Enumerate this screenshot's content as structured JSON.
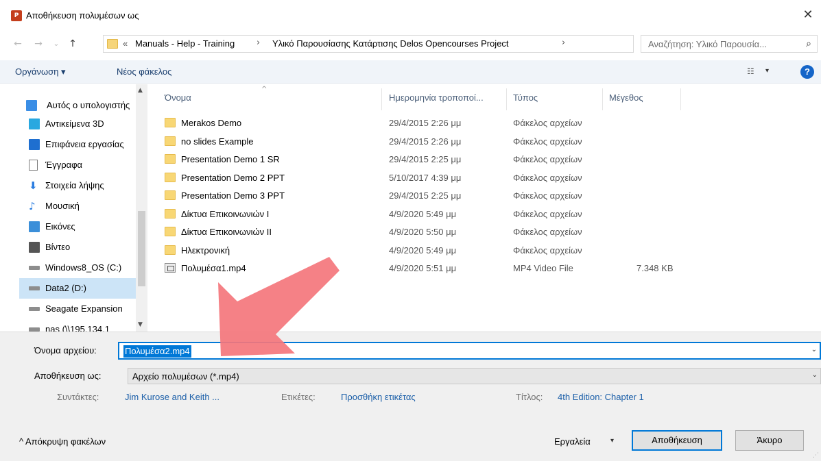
{
  "window": {
    "title": "Αποθήκευση πολυμέσων ως",
    "app_icon_text": "P",
    "close_glyph": "✕"
  },
  "address": {
    "back_glyph": "←",
    "forward_glyph": "→",
    "recent_glyph": "⌄",
    "up_glyph": "↑",
    "overflow": "«",
    "crumbs": [
      "Manuals - Help - Training",
      "Υλικό Παρουσίασης Κατάρτισης Delos Opencourses Project"
    ],
    "sep": "›",
    "dropdown_glyph": "⌄",
    "refresh_glyph": "↻",
    "search_placeholder": "Αναζήτηση: Υλικό Παρουσία...",
    "search_glyph": "⌕"
  },
  "toolbar": {
    "organize": "Οργάνωση ▾",
    "new_folder": "Νέος φάκελος",
    "view_glyph": "☷",
    "view_arrow": "▾",
    "help": "?"
  },
  "nav": {
    "items": [
      {
        "label": "Αυτός ο υπολογιστής",
        "icon": "computer-icon",
        "color": "#3a8ee6"
      },
      {
        "label": "Αντικείμενα 3D",
        "icon": "cube-3d-icon",
        "color": "#29a8e0"
      },
      {
        "label": "Επιφάνεια εργασίας",
        "icon": "desktop-icon",
        "color": "#1e6fd0"
      },
      {
        "label": "Έγγραφα",
        "icon": "document-icon",
        "color": "#8a8a8a"
      },
      {
        "label": "Στοιχεία λήψης",
        "icon": "download-icon",
        "color": "#2b7de0"
      },
      {
        "label": "Μουσική",
        "icon": "music-icon",
        "color": "#2b7de0"
      },
      {
        "label": "Εικόνες",
        "icon": "pictures-icon",
        "color": "#3b8fd9"
      },
      {
        "label": "Βίντεο",
        "icon": "video-film-icon",
        "color": "#555555"
      },
      {
        "label": "Windows8_OS (C:)",
        "icon": "drive-windows-icon",
        "color": "#777777"
      },
      {
        "label": "Data2 (D:)",
        "icon": "drive-icon",
        "color": "#777777"
      },
      {
        "label": "Seagate Expansion",
        "icon": "drive-icon",
        "color": "#777777"
      },
      {
        "label": "nas (\\\\195.134.1",
        "icon": "network-drive-icon",
        "color": "#777777"
      }
    ],
    "selected_index": 9,
    "scroll_up": "▲",
    "scroll_down": "▼"
  },
  "files": {
    "columns": [
      "Όνομα",
      "Ημερομηνία τροποποί...",
      "Τύπος",
      "Μέγεθος"
    ],
    "sort_glyph": "^",
    "rows": [
      {
        "name": "Merakos Demo",
        "date": "29/4/2015 2:26 μμ",
        "type": "Φάκελος αρχείων",
        "size": "",
        "kind": "folder"
      },
      {
        "name": "no slides Example",
        "date": "29/4/2015 2:26 μμ",
        "type": "Φάκελος αρχείων",
        "size": "",
        "kind": "folder"
      },
      {
        "name": "Presentation Demo 1 SR",
        "date": "29/4/2015 2:25 μμ",
        "type": "Φάκελος αρχείων",
        "size": "",
        "kind": "folder"
      },
      {
        "name": "Presentation Demo 2 PPT",
        "date": "5/10/2017 4:39 μμ",
        "type": "Φάκελος αρχείων",
        "size": "",
        "kind": "folder"
      },
      {
        "name": "Presentation Demo 3 PPT",
        "date": "29/4/2015 2:25 μμ",
        "type": "Φάκελος αρχείων",
        "size": "",
        "kind": "folder"
      },
      {
        "name": "Δίκτυα Επικοινωνιών Ι",
        "date": "4/9/2020 5:49 μμ",
        "type": "Φάκελος αρχείων",
        "size": "",
        "kind": "folder"
      },
      {
        "name": "Δίκτυα Επικοινωνιών ΙΙ",
        "date": "4/9/2020 5:50 μμ",
        "type": "Φάκελος αρχείων",
        "size": "",
        "kind": "folder"
      },
      {
        "name": "Ηλεκτρονική",
        "date": "4/9/2020 5:49 μμ",
        "type": "Φάκελος αρχείων",
        "size": "",
        "kind": "folder"
      },
      {
        "name": "Πολυμέσα1.mp4",
        "date": "4/9/2020 5:51 μμ",
        "type": "MP4 Video File",
        "size": "7.348 KB",
        "kind": "video"
      }
    ]
  },
  "form": {
    "filename_label": "Όνομα αρχείου:",
    "filename_value": "Πολυμέσα2.mp4",
    "savetype_label": "Αποθήκευση ως:",
    "savetype_value": "Αρχείο πολυμέσων (*.mp4)",
    "drop_glyph": "⌄",
    "authors_label": "Συντάκτες:",
    "authors_value": "Jim Kurose and Keith ...",
    "tags_label": "Ετικέτες:",
    "tags_value": "Προσθήκη ετικέτας",
    "title_label": "Τίτλος:",
    "title_value": "4th Edition: Chapter 1",
    "hide_folders": "^  Απόκρυψη φακέλων",
    "tools": "Εργαλεία",
    "tools_arrow": "▾",
    "save": "Αποθήκευση",
    "cancel": "Άκυρο",
    "grip": "⋰"
  },
  "colors": {
    "accent": "#0078d7",
    "annotation_arrow": "#f4767c"
  }
}
